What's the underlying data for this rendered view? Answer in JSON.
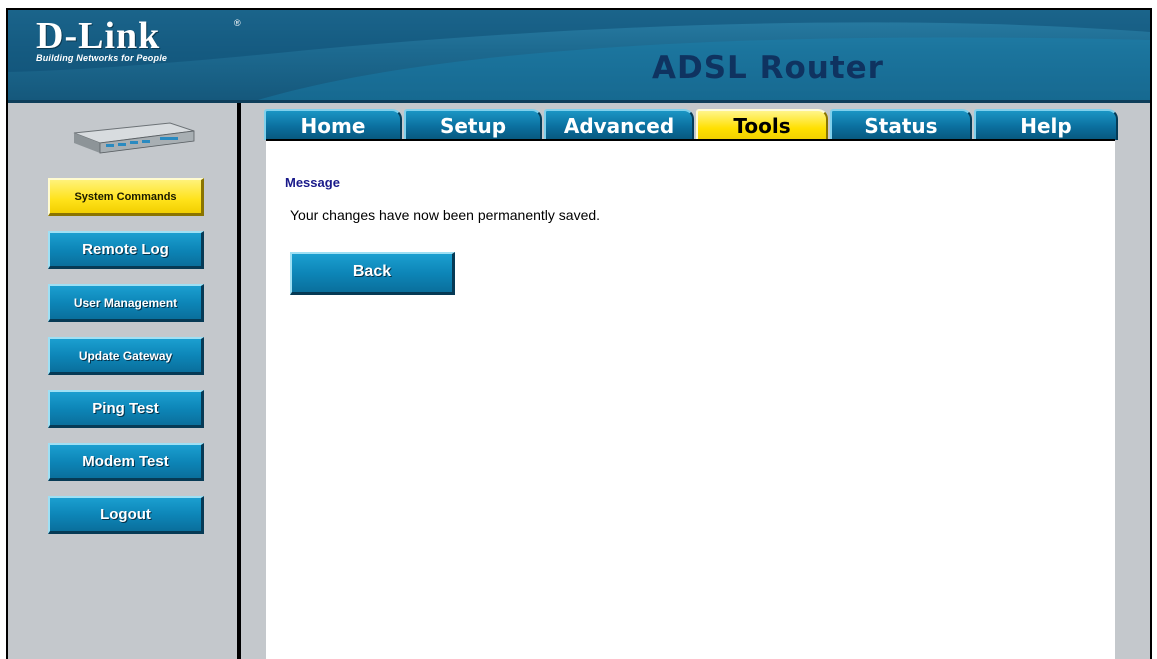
{
  "header": {
    "logo_text": "D-Link",
    "logo_registered": "®",
    "logo_tagline": "Building Networks for People",
    "product_title": "ADSL Router"
  },
  "tabs": [
    {
      "label": "Home",
      "active": false
    },
    {
      "label": "Setup",
      "active": false
    },
    {
      "label": "Advanced",
      "active": false
    },
    {
      "label": "Tools",
      "active": true
    },
    {
      "label": "Status",
      "active": false
    },
    {
      "label": "Help",
      "active": false
    }
  ],
  "sidebar": {
    "items": [
      {
        "label": "System Commands",
        "active": true
      },
      {
        "label": "Remote Log",
        "active": false
      },
      {
        "label": "User Management",
        "active": false
      },
      {
        "label": "Update Gateway",
        "active": false
      },
      {
        "label": "Ping Test",
        "active": false
      },
      {
        "label": "Modem Test",
        "active": false
      },
      {
        "label": "Logout",
        "active": false
      }
    ]
  },
  "content": {
    "heading": "Message",
    "text": "Your changes have now been permanently saved.",
    "back_label": "Back"
  },
  "colors": {
    "header_blue": "#1d6a90",
    "button_blue": "#0d86b8",
    "active_yellow": "#ffe21a",
    "title_navy": "#0f3360",
    "heading_blue": "#1a1a8a",
    "panel_gray": "#c4c8cc"
  }
}
